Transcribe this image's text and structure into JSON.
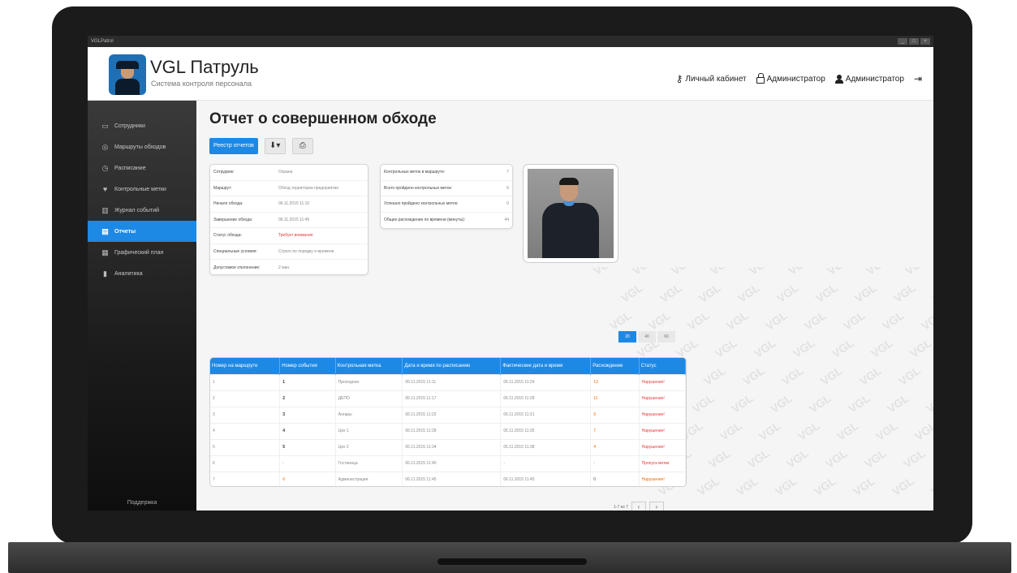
{
  "window": {
    "title": "VGLPatrol"
  },
  "app": {
    "name": "VGL Патруль",
    "subtitle": "Система контроля персонала"
  },
  "header_links": [
    {
      "label": "Личный кабинет",
      "icon": "key-icon"
    },
    {
      "label": "Администратор",
      "icon": "lock-icon"
    },
    {
      "label": "Администратор",
      "icon": "user-icon"
    }
  ],
  "sidebar": {
    "items": [
      {
        "label": "Сотрудники",
        "icon": "id-card-icon",
        "active": false
      },
      {
        "label": "Маршруты обходов",
        "icon": "compass-icon",
        "active": false
      },
      {
        "label": "Расписание",
        "icon": "clock-icon",
        "active": false
      },
      {
        "label": "Контрольные метки",
        "icon": "pin-icon",
        "active": false
      },
      {
        "label": "Журнал событий",
        "icon": "book-icon",
        "active": false
      },
      {
        "label": "Отчеты",
        "icon": "report-icon",
        "active": true
      },
      {
        "label": "Графический план",
        "icon": "map-icon",
        "active": false
      },
      {
        "label": "Аналитика",
        "icon": "analytics-icon",
        "active": false
      }
    ],
    "support": "Поддержка"
  },
  "page": {
    "title": "Отчет о совершенном обходе",
    "registry_button": "Реестр отчетов"
  },
  "info_card": [
    {
      "label": "Сотрудник:",
      "value": "Охрана"
    },
    {
      "label": "Маршрут:",
      "value": "Обход территории предприятия"
    },
    {
      "label": "Начало обхода:",
      "value": "06.11.2015 11:10"
    },
    {
      "label": "Завершение обхода:",
      "value": "06.11.2015 11:45"
    },
    {
      "label": "Статус обхода:",
      "value": "Требует внимания"
    },
    {
      "label": "Специальные условия:",
      "value": "Строго по порядку и времени"
    },
    {
      "label": "Допустимое отклонение:",
      "value": "2 мин."
    }
  ],
  "stats_card": [
    {
      "label": "Контрольных меток в маршруте:",
      "value": "7"
    },
    {
      "label": "Всего пройдено контрольных меток:",
      "value": "6"
    },
    {
      "label": "Успешно пройдено контрольных меток:",
      "value": "0"
    },
    {
      "label": "Общее расхождение по времени (минуты):",
      "value": "44"
    }
  ],
  "pagination": [
    "20",
    "40",
    "60"
  ],
  "table": {
    "headers": [
      "Номер на маршруте",
      "Номер события",
      "Контрольная метка",
      "Дата и время по расписанию",
      "Фактические дата и время",
      "Расхождение",
      "Статус"
    ],
    "rows": [
      {
        "c1": "1",
        "c2": "1",
        "c3": "Проходная",
        "c4": "06.11.2015 11:11",
        "c5": "06.11.2015 11:24",
        "c6": "13",
        "c7": "Нарушение!"
      },
      {
        "c1": "2",
        "c2": "2",
        "c3": "ДЕПО",
        "c4": "06.11.2015 11:17",
        "c5": "06.11.2015 11:28",
        "c6": "11",
        "c7": "Нарушение!"
      },
      {
        "c1": "3",
        "c2": "3",
        "c3": "Ангары",
        "c4": "06.11.2015 11:22",
        "c5": "06.11.2015 11:31",
        "c6": "9",
        "c7": "Нарушение!"
      },
      {
        "c1": "4",
        "c2": "4",
        "c3": "Цех 1",
        "c4": "06.11.2015 11:28",
        "c5": "06.11.2015 11:35",
        "c6": "7",
        "c7": "Нарушение!"
      },
      {
        "c1": "5",
        "c2": "5",
        "c3": "Цех 2",
        "c4": "06.11.2015 11:34",
        "c5": "06.11.2015 11:38",
        "c6": "4",
        "c7": "Нарушение!"
      },
      {
        "c1": "6",
        "c2": "-",
        "c3": "Гостиница",
        "c4": "06.11.2015 11:40",
        "c5": "-",
        "c6": "-",
        "c7": "Пропуск метки"
      },
      {
        "c1": "7",
        "c2": "6",
        "c3": "Администрация",
        "c4": "06.11.2015 11:45",
        "c5": "06.11.2015 11:45",
        "c6": "0",
        "c7": "Нарушение!"
      }
    ]
  },
  "table_footer": {
    "range": "1-7 из 7",
    "prev": "‹",
    "next": "›"
  },
  "watermark": "VGL",
  "colors": {
    "accent": "#1e88e5",
    "danger": "#e53935",
    "warning": "#ef6c00"
  }
}
